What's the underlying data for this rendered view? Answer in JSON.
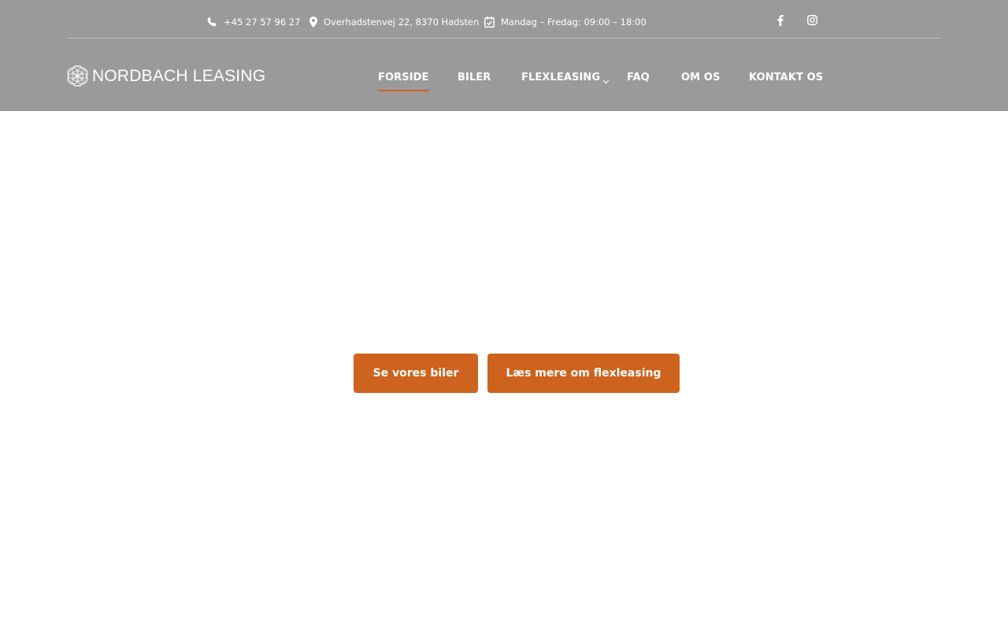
{
  "topbar": {
    "phone": "+45 27 57 96 27",
    "address": "Overhadstenvej 22, 8370 Hadsten",
    "hours": "Mandag – Fredag: 09:00 – 18:00",
    "icons": [
      "phone-icon",
      "map-pin-icon",
      "calendar-check-icon",
      "facebook-icon",
      "instagram-icon"
    ]
  },
  "brand": {
    "logo_text": "NORDBACH LEASING"
  },
  "nav": {
    "items": [
      {
        "label": "FORSIDE",
        "active": true
      },
      {
        "label": "BILER",
        "active": false
      },
      {
        "label": "FLEXLEASING",
        "active": false,
        "has_dropdown": true
      },
      {
        "label": "FAQ",
        "active": false
      },
      {
        "label": "OM OS",
        "active": false
      },
      {
        "label": "KONTAKT OS",
        "active": false
      }
    ]
  },
  "hero": {
    "primary_cta": "Se vores biler",
    "secondary_cta": "Læs mere om flexleasing"
  },
  "colors": {
    "header_bg": "#9a9a9a",
    "accent": "#cd631d",
    "text_on_header": "#ffffff",
    "page_bg": "#ffffff"
  }
}
